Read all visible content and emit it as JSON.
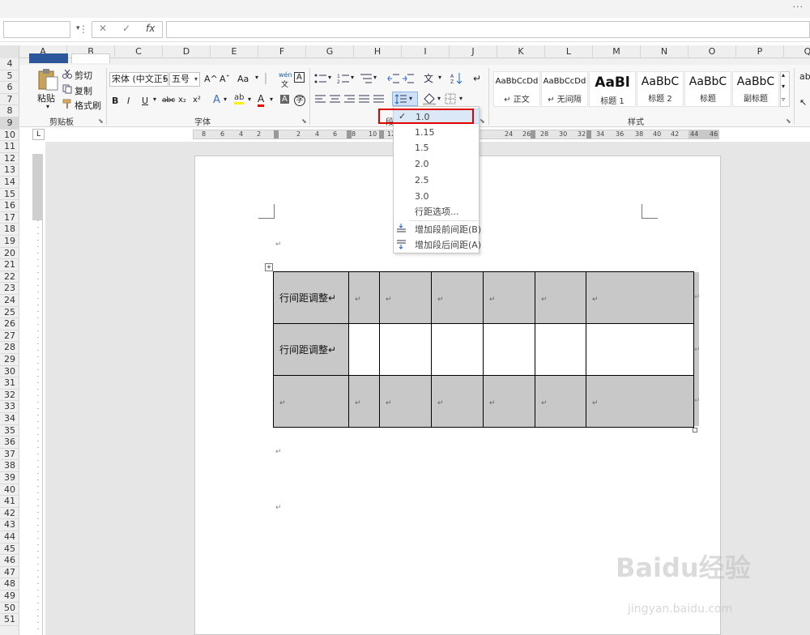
{
  "excel": {
    "name_box": "",
    "fx_label": "fx",
    "cancel_glyph": "✕",
    "enter_glyph": "✓",
    "formula_value": "",
    "more_glyph": "···",
    "columns": [
      "A",
      "B",
      "C",
      "D",
      "E",
      "F",
      "G",
      "H",
      "I",
      "J",
      "K",
      "L",
      "M",
      "N",
      "O",
      "P",
      "Q"
    ],
    "rows": [
      "4",
      "5",
      "6",
      "7",
      "8",
      "9",
      "10",
      "11",
      "12",
      "13",
      "14",
      "15",
      "16",
      "17",
      "18",
      "19",
      "20",
      "21",
      "22",
      "23",
      "24",
      "25",
      "26",
      "27",
      "28",
      "29",
      "30",
      "31",
      "32",
      "33",
      "34",
      "35",
      "36",
      "37",
      "38",
      "39",
      "40",
      "41",
      "42",
      "43",
      "44",
      "45",
      "46",
      "47",
      "48",
      "49",
      "50",
      "51"
    ]
  },
  "word": {
    "clipboard": {
      "paste": "粘贴",
      "cut": "剪切",
      "copy": "复制",
      "format_painter": "格式刷",
      "group_label": "剪贴板"
    },
    "font": {
      "font_name": "宋体 (中文正5",
      "font_size": "五号",
      "group_label": "字体",
      "bold": "B",
      "italic": "I",
      "underline": "U",
      "strike": "abc",
      "sub": "x₂",
      "sup": "x²",
      "grow": "A^",
      "shrink": "Aˇ",
      "case": "Aa",
      "pinyin": "wén",
      "border_char": "A",
      "font_color": "A"
    },
    "paragraph": {
      "group_label": "段"
    },
    "styles": {
      "group_label": "样式",
      "items": [
        {
          "sample": "AaBbCcDd",
          "name": "↵ 正文"
        },
        {
          "sample": "AaBbCcDd",
          "name": "↵ 无间隔"
        },
        {
          "sample": "AaBl",
          "name": "标题 1"
        },
        {
          "sample": "AaBbC",
          "name": "标题 2"
        },
        {
          "sample": "AaBbC",
          "name": "标题"
        },
        {
          "sample": "AaBbC",
          "name": "副标题"
        }
      ]
    },
    "ruler": {
      "corner": "L",
      "ticks": [
        "8",
        "6",
        "4",
        "2",
        "2",
        "4",
        "6",
        "8",
        "10",
        "12",
        "24",
        "26",
        "28",
        "30",
        "32",
        "34",
        "36",
        "38",
        "40",
        "42",
        "44",
        "46"
      ]
    },
    "line_spacing_menu": {
      "items": [
        "1.0",
        "1.15",
        "1.5",
        "2.0",
        "2.5",
        "3.0"
      ],
      "selected": "1.0",
      "options_label": "行距选项...",
      "add_before": "增加段前间距(B)",
      "add_after": "增加段后间距(A)"
    },
    "table": {
      "rows": [
        [
          "行间距调整↵",
          "↵",
          "↵",
          "↵",
          "↵",
          "↵",
          "↵"
        ],
        [
          "行间距调整↵",
          "",
          "",
          "",
          "",
          "",
          ""
        ],
        [
          "↵",
          "↵",
          "↵",
          "↵",
          "↵",
          "↵",
          "↵"
        ]
      ],
      "row_end": "↵"
    },
    "para_mark": "↵"
  },
  "watermark": {
    "text": "Baidu经验",
    "sub": "jingyan.baidu.com"
  }
}
